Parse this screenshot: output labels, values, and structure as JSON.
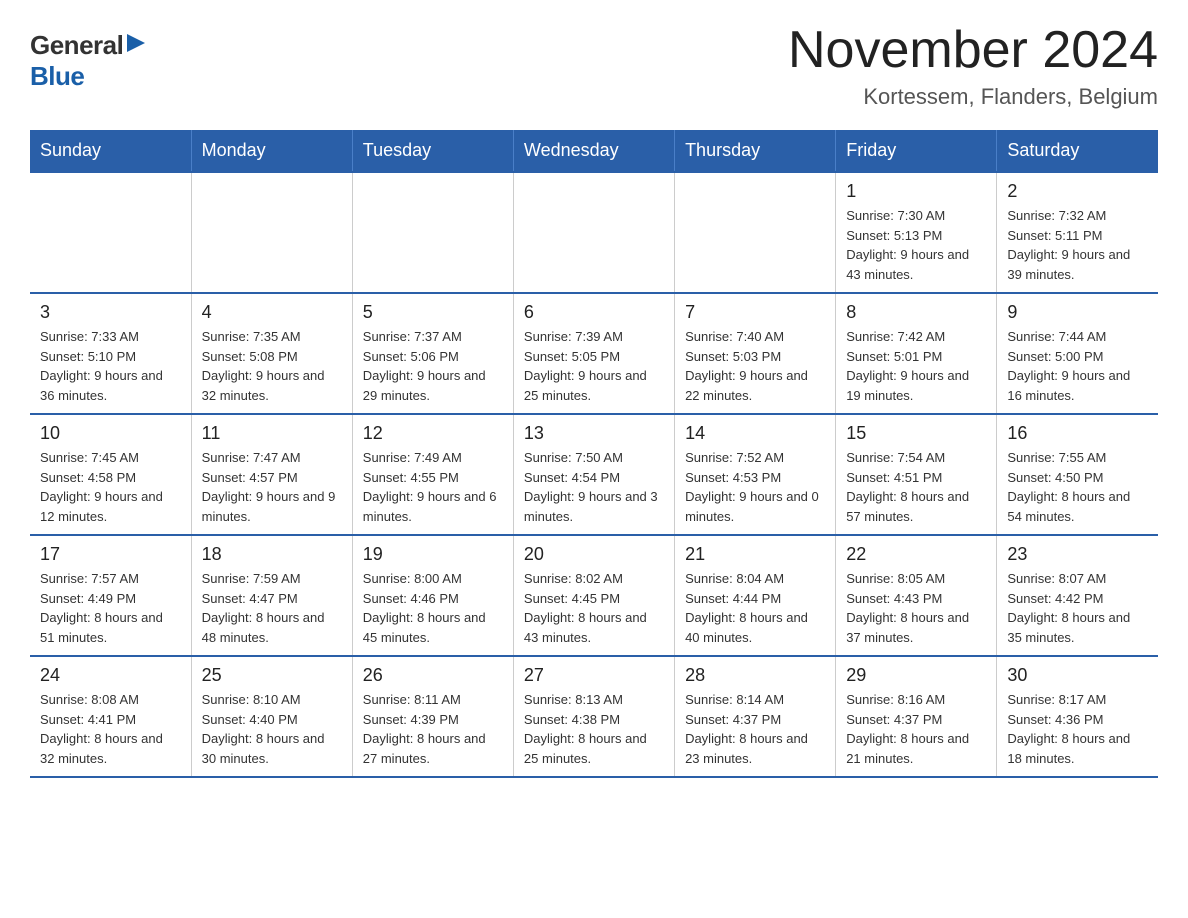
{
  "logo": {
    "general": "General",
    "blue": "Blue"
  },
  "title": "November 2024",
  "location": "Kortessem, Flanders, Belgium",
  "days_of_week": [
    "Sunday",
    "Monday",
    "Tuesday",
    "Wednesday",
    "Thursday",
    "Friday",
    "Saturday"
  ],
  "weeks": [
    [
      {
        "day": "",
        "info": ""
      },
      {
        "day": "",
        "info": ""
      },
      {
        "day": "",
        "info": ""
      },
      {
        "day": "",
        "info": ""
      },
      {
        "day": "",
        "info": ""
      },
      {
        "day": "1",
        "info": "Sunrise: 7:30 AM\nSunset: 5:13 PM\nDaylight: 9 hours and 43 minutes."
      },
      {
        "day": "2",
        "info": "Sunrise: 7:32 AM\nSunset: 5:11 PM\nDaylight: 9 hours and 39 minutes."
      }
    ],
    [
      {
        "day": "3",
        "info": "Sunrise: 7:33 AM\nSunset: 5:10 PM\nDaylight: 9 hours and 36 minutes."
      },
      {
        "day": "4",
        "info": "Sunrise: 7:35 AM\nSunset: 5:08 PM\nDaylight: 9 hours and 32 minutes."
      },
      {
        "day": "5",
        "info": "Sunrise: 7:37 AM\nSunset: 5:06 PM\nDaylight: 9 hours and 29 minutes."
      },
      {
        "day": "6",
        "info": "Sunrise: 7:39 AM\nSunset: 5:05 PM\nDaylight: 9 hours and 25 minutes."
      },
      {
        "day": "7",
        "info": "Sunrise: 7:40 AM\nSunset: 5:03 PM\nDaylight: 9 hours and 22 minutes."
      },
      {
        "day": "8",
        "info": "Sunrise: 7:42 AM\nSunset: 5:01 PM\nDaylight: 9 hours and 19 minutes."
      },
      {
        "day": "9",
        "info": "Sunrise: 7:44 AM\nSunset: 5:00 PM\nDaylight: 9 hours and 16 minutes."
      }
    ],
    [
      {
        "day": "10",
        "info": "Sunrise: 7:45 AM\nSunset: 4:58 PM\nDaylight: 9 hours and 12 minutes."
      },
      {
        "day": "11",
        "info": "Sunrise: 7:47 AM\nSunset: 4:57 PM\nDaylight: 9 hours and 9 minutes."
      },
      {
        "day": "12",
        "info": "Sunrise: 7:49 AM\nSunset: 4:55 PM\nDaylight: 9 hours and 6 minutes."
      },
      {
        "day": "13",
        "info": "Sunrise: 7:50 AM\nSunset: 4:54 PM\nDaylight: 9 hours and 3 minutes."
      },
      {
        "day": "14",
        "info": "Sunrise: 7:52 AM\nSunset: 4:53 PM\nDaylight: 9 hours and 0 minutes."
      },
      {
        "day": "15",
        "info": "Sunrise: 7:54 AM\nSunset: 4:51 PM\nDaylight: 8 hours and 57 minutes."
      },
      {
        "day": "16",
        "info": "Sunrise: 7:55 AM\nSunset: 4:50 PM\nDaylight: 8 hours and 54 minutes."
      }
    ],
    [
      {
        "day": "17",
        "info": "Sunrise: 7:57 AM\nSunset: 4:49 PM\nDaylight: 8 hours and 51 minutes."
      },
      {
        "day": "18",
        "info": "Sunrise: 7:59 AM\nSunset: 4:47 PM\nDaylight: 8 hours and 48 minutes."
      },
      {
        "day": "19",
        "info": "Sunrise: 8:00 AM\nSunset: 4:46 PM\nDaylight: 8 hours and 45 minutes."
      },
      {
        "day": "20",
        "info": "Sunrise: 8:02 AM\nSunset: 4:45 PM\nDaylight: 8 hours and 43 minutes."
      },
      {
        "day": "21",
        "info": "Sunrise: 8:04 AM\nSunset: 4:44 PM\nDaylight: 8 hours and 40 minutes."
      },
      {
        "day": "22",
        "info": "Sunrise: 8:05 AM\nSunset: 4:43 PM\nDaylight: 8 hours and 37 minutes."
      },
      {
        "day": "23",
        "info": "Sunrise: 8:07 AM\nSunset: 4:42 PM\nDaylight: 8 hours and 35 minutes."
      }
    ],
    [
      {
        "day": "24",
        "info": "Sunrise: 8:08 AM\nSunset: 4:41 PM\nDaylight: 8 hours and 32 minutes."
      },
      {
        "day": "25",
        "info": "Sunrise: 8:10 AM\nSunset: 4:40 PM\nDaylight: 8 hours and 30 minutes."
      },
      {
        "day": "26",
        "info": "Sunrise: 8:11 AM\nSunset: 4:39 PM\nDaylight: 8 hours and 27 minutes."
      },
      {
        "day": "27",
        "info": "Sunrise: 8:13 AM\nSunset: 4:38 PM\nDaylight: 8 hours and 25 minutes."
      },
      {
        "day": "28",
        "info": "Sunrise: 8:14 AM\nSunset: 4:37 PM\nDaylight: 8 hours and 23 minutes."
      },
      {
        "day": "29",
        "info": "Sunrise: 8:16 AM\nSunset: 4:37 PM\nDaylight: 8 hours and 21 minutes."
      },
      {
        "day": "30",
        "info": "Sunrise: 8:17 AM\nSunset: 4:36 PM\nDaylight: 8 hours and 18 minutes."
      }
    ]
  ]
}
